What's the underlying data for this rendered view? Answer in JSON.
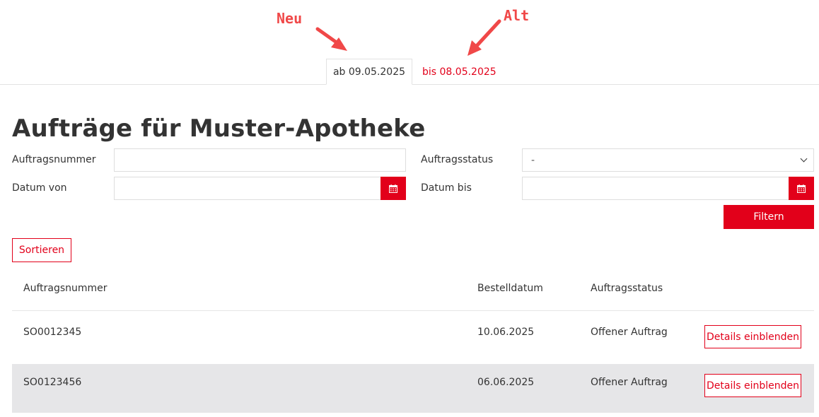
{
  "annotations": {
    "new_label": "Neu",
    "old_label": "Alt"
  },
  "tabs": [
    {
      "label": "ab 09.05.2025",
      "active": true
    },
    {
      "label": "bis 08.05.2025",
      "active": false
    }
  ],
  "page_title": "Aufträge für Muster-Apotheke",
  "filters": {
    "order_number_label": "Auftragsnummer",
    "order_number_value": "",
    "status_label": "Auftragsstatus",
    "status_value": "-",
    "date_from_label": "Datum von",
    "date_from_value": "",
    "date_to_label": "Datum bis",
    "date_to_value": "",
    "filter_button": "Filtern"
  },
  "sort_button": "Sortieren",
  "table": {
    "columns": [
      "Auftragsnummer",
      "Bestelldatum",
      "Auftragsstatus"
    ],
    "rows": [
      {
        "order_number": "SO0012345",
        "date": "10.06.2025",
        "status": "Offener Auftrag",
        "action": "Details einblenden"
      },
      {
        "order_number": "SO0123456",
        "date": "06.06.2025",
        "status": "Offener Auftrag",
        "action": "Details einblenden"
      }
    ]
  },
  "colors": {
    "accent": "#e2001a",
    "annotation": "#f04848",
    "row_alt": "#e6e6e8"
  },
  "icons": {
    "calendar": "calendar-icon",
    "dropdown": "chevron-down-icon",
    "arrow": "arrow-icon"
  }
}
